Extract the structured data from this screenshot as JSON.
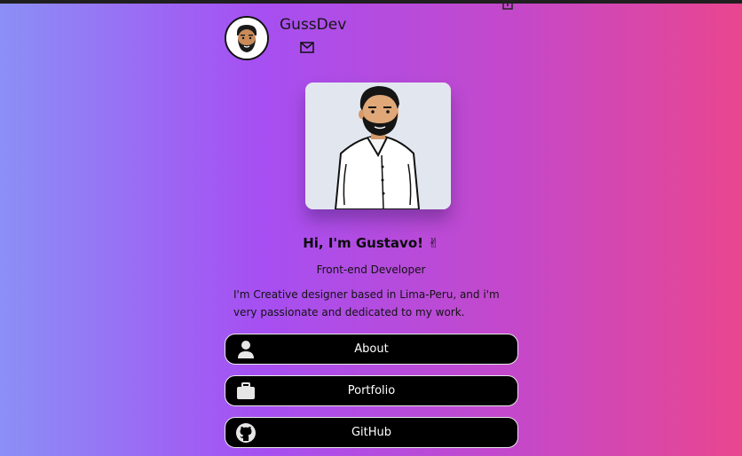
{
  "header": {
    "brand": "GussDev",
    "icons": [
      "avatar",
      "mail-icon"
    ]
  },
  "hero": {
    "title": "Hi, I'm Gustavo!",
    "title_emoji": "✌",
    "subtitle": "Front-end Developer",
    "bio": "I'm Creative designer based in Lima-Peru, and i'm very passionate and dedicated to my work."
  },
  "links": [
    {
      "label": "About",
      "icon": "user-icon"
    },
    {
      "label": "Portfolio",
      "icon": "briefcase-icon"
    },
    {
      "label": "GitHub",
      "icon": "github-icon"
    }
  ],
  "colors": {
    "gradient_left": "#8b8ff6",
    "gradient_mid": "#a64ff2",
    "gradient_right": "#e9468f",
    "button_bg": "#000000",
    "button_text": "#ffffff"
  }
}
